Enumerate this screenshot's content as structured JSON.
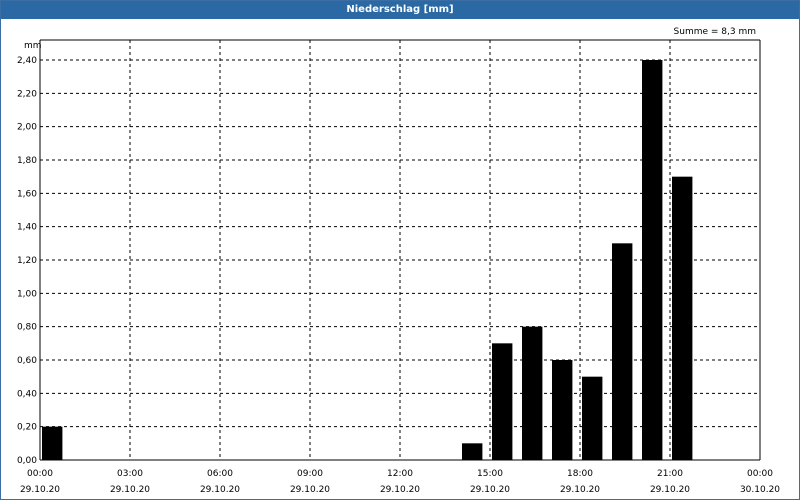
{
  "window": {
    "title": "Niederschlag [mm]"
  },
  "chart_data": {
    "type": "bar",
    "title": "Niederschlag [mm]",
    "ylabel": "mm",
    "ylim": [
      0,
      2.4
    ],
    "y_ticks": [
      "0,00",
      "0,20",
      "0,40",
      "0,60",
      "0,80",
      "1,00",
      "1,20",
      "1,40",
      "1,60",
      "1,80",
      "2,00",
      "2,20",
      "2,40"
    ],
    "x_range_hours": [
      0,
      24
    ],
    "x_ticks": [
      {
        "time": "00:00",
        "date": "29.10.20"
      },
      {
        "time": "03:00",
        "date": "29.10.20"
      },
      {
        "time": "06:00",
        "date": "29.10.20"
      },
      {
        "time": "09:00",
        "date": "29.10.20"
      },
      {
        "time": "12:00",
        "date": "29.10.20"
      },
      {
        "time": "15:00",
        "date": "29.10.20"
      },
      {
        "time": "18:00",
        "date": "29.10.20"
      },
      {
        "time": "21:00",
        "date": "29.10.20"
      },
      {
        "time": "00:00",
        "date": "30.10.20"
      }
    ],
    "bars": [
      {
        "hour": 0,
        "value": 0.2
      },
      {
        "hour": 14,
        "value": 0.1
      },
      {
        "hour": 15,
        "value": 0.7
      },
      {
        "hour": 16,
        "value": 0.8
      },
      {
        "hour": 17,
        "value": 0.6
      },
      {
        "hour": 18,
        "value": 0.5
      },
      {
        "hour": 19,
        "value": 1.3
      },
      {
        "hour": 20,
        "value": 2.4
      },
      {
        "hour": 21,
        "value": 1.7
      }
    ],
    "sum_label": "Summe = 8,3 mm",
    "grid": true,
    "bar_color": "#000000"
  }
}
